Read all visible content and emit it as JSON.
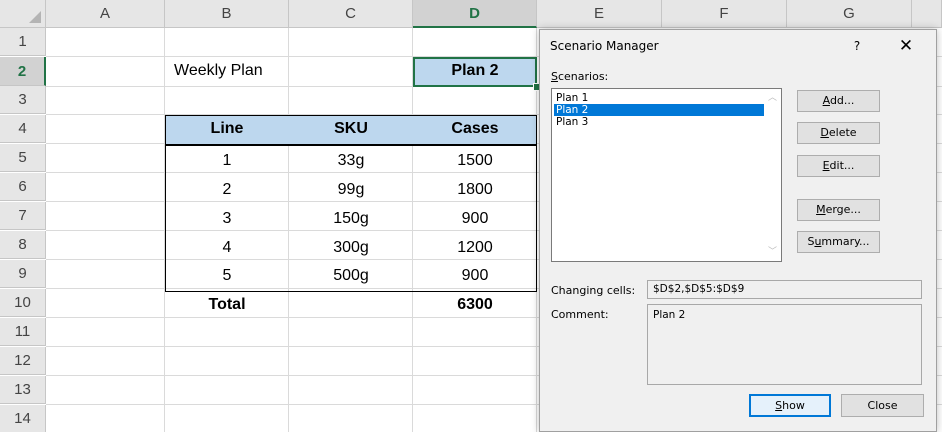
{
  "sheet": {
    "columns": [
      "A",
      "B",
      "C",
      "D",
      "E",
      "F",
      "G"
    ],
    "selected_column": "D",
    "rows": [
      "1",
      "2",
      "3",
      "4",
      "5",
      "6",
      "7",
      "8",
      "9",
      "10",
      "11",
      "12",
      "13",
      "14"
    ],
    "selected_row": "2",
    "b2": "Weekly Plan",
    "d2": "Plan 2",
    "table_headers": [
      "Line",
      "SKU",
      "Cases"
    ],
    "table_rows": [
      [
        "1",
        "33g",
        "1500"
      ],
      [
        "2",
        "99g",
        "1800"
      ],
      [
        "3",
        "150g",
        "900"
      ],
      [
        "4",
        "300g",
        "1200"
      ],
      [
        "5",
        "500g",
        "900"
      ]
    ],
    "total_label": "Total",
    "total_value": "6300",
    "header_fill_color": "#bdd7ee",
    "accent_color": "#217346"
  },
  "dialog": {
    "title": "Scenario Manager",
    "help_glyph": "?",
    "close_glyph": "✕",
    "scenarios_label_pre": "",
    "scenarios_label_key": "S",
    "scenarios_label_post": "cenarios:",
    "scenarios": [
      "Plan 1",
      "Plan 2",
      "Plan 3"
    ],
    "selected_scenario": "Plan 2",
    "buttons": {
      "add": {
        "key": "A",
        "rest": "dd..."
      },
      "delete": {
        "key": "D",
        "rest": "elete"
      },
      "edit": {
        "key": "E",
        "rest": "dit..."
      },
      "merge_pre": "",
      "merge": {
        "key": "M",
        "rest": "erge..."
      },
      "summary_pre": "S",
      "summary": {
        "key": "u",
        "rest": "mmary..."
      }
    },
    "changing_cells_label": "Changing cells:",
    "changing_cells_value": "$D$2,$D$5:$D$9",
    "comment_label": "Comment:",
    "comment_value": "Plan 2",
    "show_key": "S",
    "show_rest": "how",
    "close_label": "Close",
    "selection_color": "#0078d7"
  }
}
